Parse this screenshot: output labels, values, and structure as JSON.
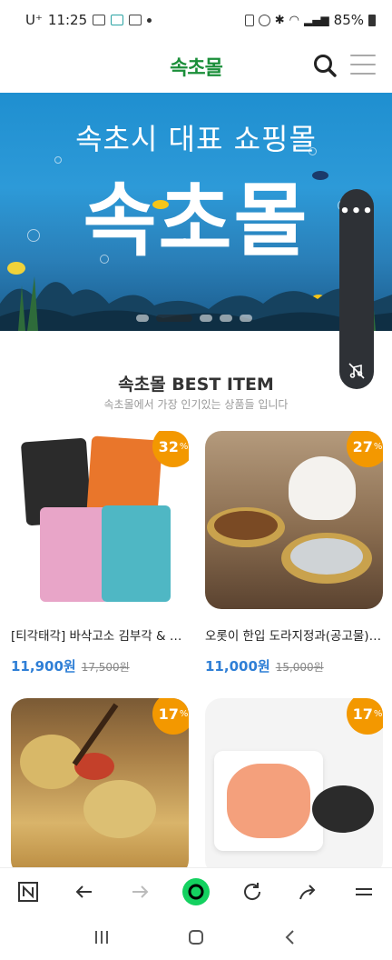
{
  "status": {
    "carrier": "U⁺",
    "time": "11:25",
    "battery": "85%"
  },
  "header": {
    "logo_text": "속초몰"
  },
  "banner": {
    "subtitle": "속초시 대표 쇼핑몰",
    "title": "속초몰"
  },
  "float_panel": {
    "more": "•••"
  },
  "best": {
    "title": "속초몰 BEST ITEM",
    "subtitle": "속초몰에서 가장 인기있는 상품들 입니다"
  },
  "products": [
    {
      "name": "[티각태각] 바삭고소 김부각 & 후...",
      "price": "11,900원",
      "orig": "17,500원",
      "discount": "32",
      "pct": "%"
    },
    {
      "name": "오롯이 한입 도라지정과(공고물) ...",
      "price": "11,000원",
      "orig": "15,000원",
      "discount": "27",
      "pct": "%"
    },
    {
      "discount": "17",
      "pct": "%"
    },
    {
      "discount": "17",
      "pct": "%"
    }
  ],
  "colors": {
    "accent": "#f39800",
    "price": "#2f7fd6",
    "brand_green": "#1b8f3a"
  }
}
